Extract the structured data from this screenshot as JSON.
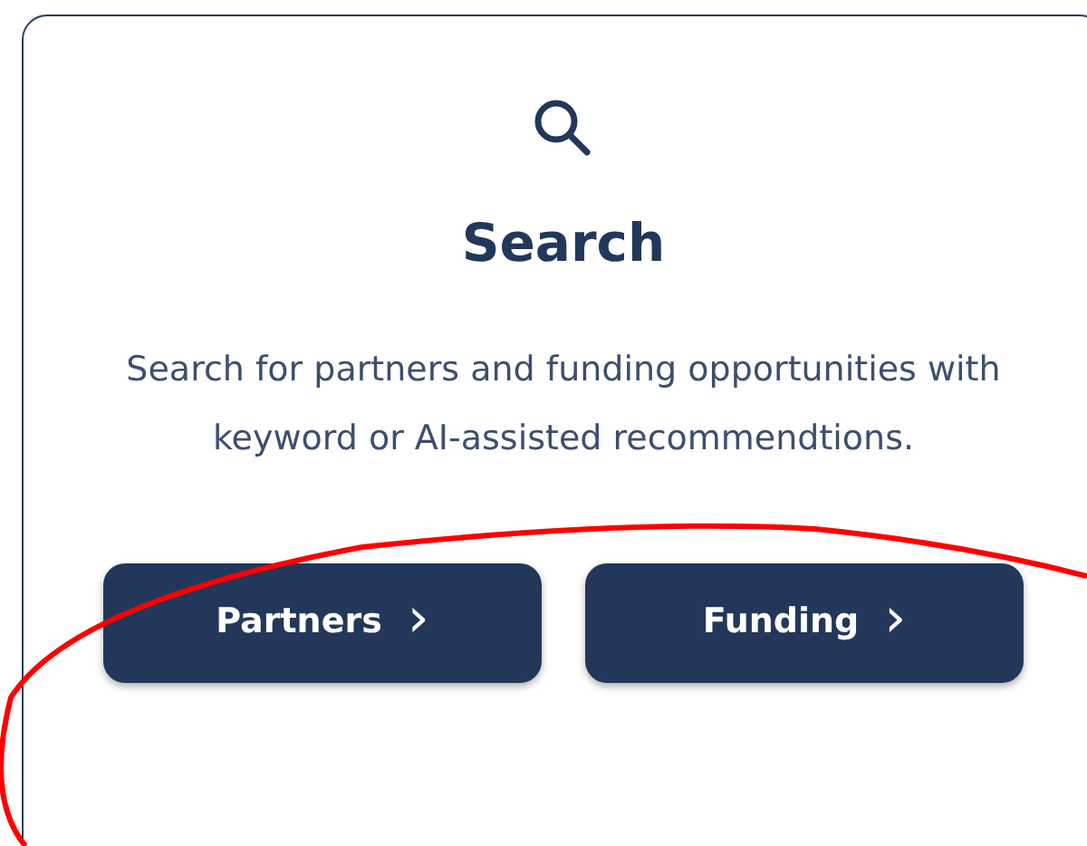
{
  "card": {
    "title": "Search",
    "description": "Search for partners and funding opportunities with keyword or AI-assisted recommendtions.",
    "buttons": [
      {
        "label": "Partners",
        "chevron": "›"
      },
      {
        "label": "Funding",
        "chevron": "›"
      }
    ]
  },
  "annotation": {
    "kind": "freehand-stroke",
    "color": "#ff0000"
  }
}
